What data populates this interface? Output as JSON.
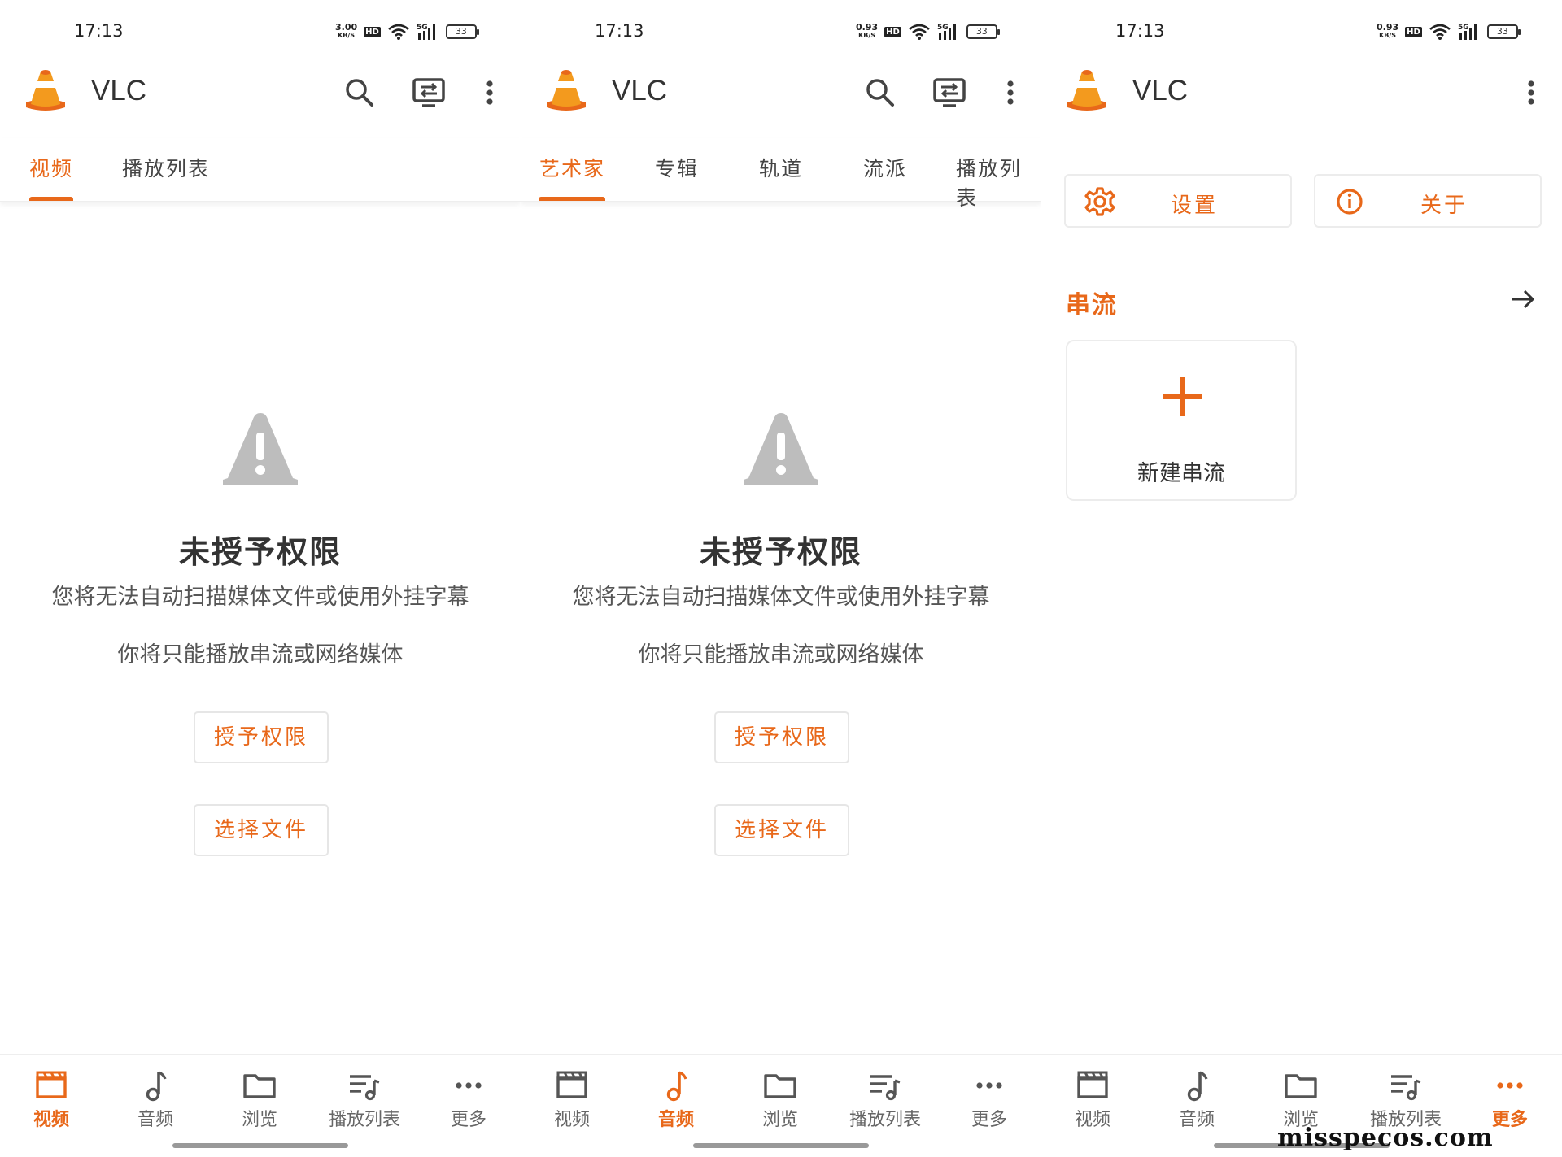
{
  "accent_color": "#e8681a",
  "panels": [
    {
      "status": {
        "time": "17:13",
        "net_speed": "3.00",
        "net_unit": "KB/S",
        "hd": "HD",
        "network": "5G",
        "battery": "33"
      },
      "app_title": "VLC",
      "tabs": [
        {
          "label": "视频",
          "active": true
        },
        {
          "label": "播放列表",
          "active": false
        }
      ],
      "empty": {
        "title": "未授予权限",
        "line1": "您将无法自动扫描媒体文件或使用外挂字幕",
        "line2": "你将只能播放串流或网络媒体",
        "grant_button": "授予权限",
        "pick_button": "选择文件"
      },
      "nav": [
        {
          "label": "视频",
          "icon": "video-icon",
          "active": true
        },
        {
          "label": "音频",
          "icon": "music-note-icon",
          "active": false
        },
        {
          "label": "浏览",
          "icon": "folder-icon",
          "active": false
        },
        {
          "label": "播放列表",
          "icon": "playlist-icon",
          "active": false
        },
        {
          "label": "更多",
          "icon": "more-dots-icon",
          "active": false
        }
      ]
    },
    {
      "status": {
        "time": "17:13",
        "net_speed": "0.93",
        "net_unit": "KB/S",
        "hd": "HD",
        "network": "5G",
        "battery": "33"
      },
      "app_title": "VLC",
      "tabs": [
        {
          "label": "艺术家",
          "active": true
        },
        {
          "label": "专辑",
          "active": false
        },
        {
          "label": "轨道",
          "active": false
        },
        {
          "label": "流派",
          "active": false
        },
        {
          "label": "播放列表",
          "active": false
        }
      ],
      "empty": {
        "title": "未授予权限",
        "line1": "您将无法自动扫描媒体文件或使用外挂字幕",
        "line2": "你将只能播放串流或网络媒体",
        "grant_button": "授予权限",
        "pick_button": "选择文件"
      },
      "nav": [
        {
          "label": "视频",
          "icon": "video-icon",
          "active": false
        },
        {
          "label": "音频",
          "icon": "music-note-icon",
          "active": true
        },
        {
          "label": "浏览",
          "icon": "folder-icon",
          "active": false
        },
        {
          "label": "播放列表",
          "icon": "playlist-icon",
          "active": false
        },
        {
          "label": "更多",
          "icon": "more-dots-icon",
          "active": false
        }
      ]
    },
    {
      "status": {
        "time": "17:13",
        "net_speed": "0.93",
        "net_unit": "KB/S",
        "hd": "HD",
        "network": "5G",
        "battery": "33"
      },
      "app_title": "VLC",
      "settings_button": "设置",
      "about_button": "关于",
      "stream_section": "串流",
      "new_stream": "新建串流",
      "nav": [
        {
          "label": "视频",
          "icon": "video-icon",
          "active": false
        },
        {
          "label": "音频",
          "icon": "music-note-icon",
          "active": false
        },
        {
          "label": "浏览",
          "icon": "folder-icon",
          "active": false
        },
        {
          "label": "播放列表",
          "icon": "playlist-icon",
          "active": false
        },
        {
          "label": "更多",
          "icon": "more-dots-icon",
          "active": true
        }
      ]
    }
  ],
  "watermark": "misspecos.com"
}
